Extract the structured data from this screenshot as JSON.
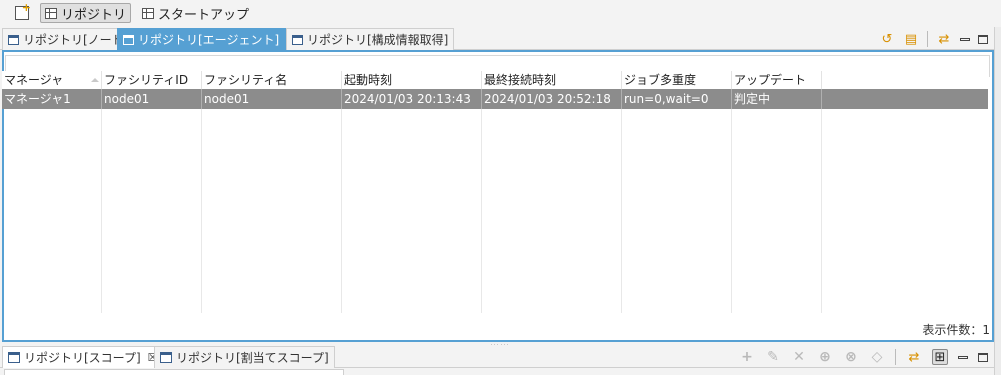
{
  "perspective_bar": {
    "repository_label": "リポジトリ",
    "startup_label": "スタートアップ"
  },
  "top_view": {
    "tabs": [
      {
        "label": "リポジトリ[ノード]"
      },
      {
        "label": "リポジトリ[エージェント]",
        "close": "☒"
      },
      {
        "label": "リポジトリ[構成情報取得]"
      }
    ],
    "columns": [
      "マネージャ",
      "ファシリティID",
      "ファシリティ名",
      "起動時刻",
      "最終接続時刻",
      "ジョブ多重度",
      "アップデート"
    ],
    "rows": [
      [
        "マネージャ1",
        "node01",
        "node01",
        "2024/01/03 20:13:43",
        "2024/01/03 20:52:18",
        "run=0,wait=0",
        "判定中"
      ]
    ],
    "status_text": "表示件数：1"
  },
  "bottom_view": {
    "tabs": [
      {
        "label": "リポジトリ[スコープ]",
        "close": "☒"
      },
      {
        "label": "リポジトリ[割当てスコープ]"
      }
    ]
  },
  "colors": {
    "active_tab": "#56a0d3",
    "selected_row": "#8c8c8c"
  },
  "icons": [
    "new-perspective-icon",
    "window-icon",
    "table-icon",
    "refresh-icon",
    "filter-icon",
    "sync-icon",
    "minimize-icon",
    "maximize-icon",
    "add-icon",
    "edit-icon",
    "delete-icon",
    "assign-icon",
    "unassign-icon",
    "clear-icon",
    "tree-icon",
    "close-icon"
  ]
}
